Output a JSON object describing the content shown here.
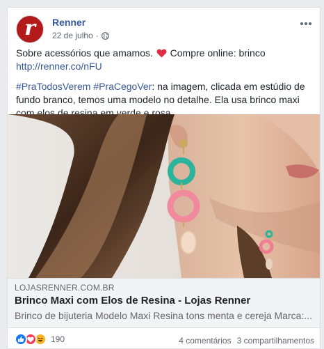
{
  "post": {
    "page_name": "Renner",
    "avatar_letter": "r",
    "date": "22 de julho",
    "separator": "·",
    "text_line1_before": "Sobre acessórios que amamos.",
    "text_line1_after": "Compre online: brinco",
    "link_url": "http://renner.co/nFU",
    "hashtag1": "#PraTodosVerem",
    "hashtag2": "#PraCegoVer",
    "description": ": na imagem, clicada em estúdio de fundo branco, temos uma modelo no detalhe. Ela usa brinco maxi com elos de resina em verde e rosa."
  },
  "link_preview": {
    "domain": "LOJASRENNER.COM.BR",
    "title": "Brinco Maxi com Elos de Resina - Lojas Renner",
    "description": "Brinco de bijuteria Modelo Maxi Resina tons menta e cereja Marca:..."
  },
  "footer": {
    "reaction_count": "190",
    "comments": "4 comentários",
    "shares": "3 compartilhamentos"
  },
  "colors": {
    "brand": "#b31b1b",
    "link": "#365899",
    "like": "#1877f2",
    "love": "#f33e58",
    "haha": "#f7b125"
  },
  "icons": [
    "globe-icon",
    "more-options-icon",
    "heart-emoji-icon",
    "like-reaction-icon",
    "love-reaction-icon",
    "haha-reaction-icon"
  ]
}
